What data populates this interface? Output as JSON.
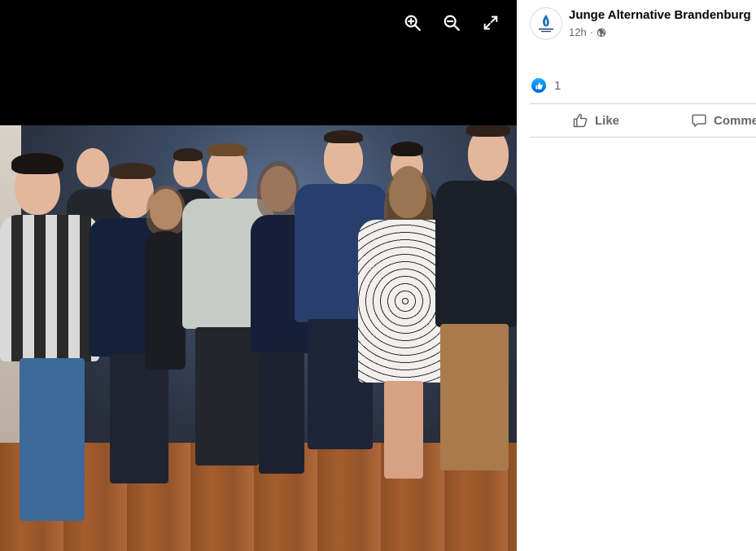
{
  "viewer": {
    "tools": [
      {
        "name": "zoom-in",
        "icon": "zoom-in-icon"
      },
      {
        "name": "zoom-out",
        "icon": "zoom-out-icon"
      },
      {
        "name": "fullscreen",
        "icon": "fullscreen-icon"
      }
    ],
    "photo_alt": "Group photo of eleven people standing on a wooden floor in front of a dark backdrop"
  },
  "post": {
    "page_name": "Junge Alternative Brandenburg",
    "time": "12h",
    "separator": "·",
    "audience_icon": "globe-icon",
    "reaction_count": "1",
    "reaction_icon": "like-reaction-icon",
    "actions": {
      "like_label": "Like",
      "comment_label": "Comment"
    }
  },
  "colors": {
    "accent": "#0866ff",
    "text_primary": "#050505",
    "text_secondary": "#65676b",
    "divider": "#ced0d4",
    "viewer_bg": "#000000"
  }
}
